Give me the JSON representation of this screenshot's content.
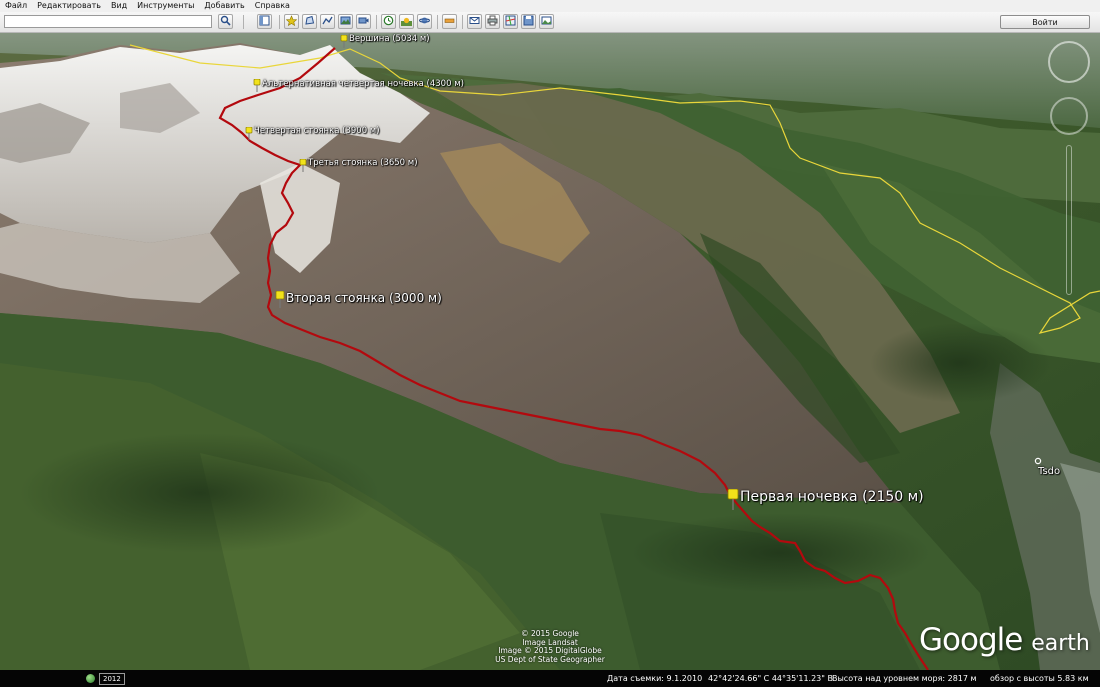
{
  "menu": [
    "Файл",
    "Редактировать",
    "Вид",
    "Инструменты",
    "Добавить",
    "Справка"
  ],
  "toolbar": {
    "search_value": "",
    "login_label": "Войти"
  },
  "map": {
    "summit_label": "Вершина (5034 м)",
    "alt_fourth_camp_label": "Альтернативная четвертая ночевка (4300 м)",
    "fourth_camp_label": "Четвертая стоянка (3900 м)",
    "third_camp_label": "Третья стоянка (3650 м)",
    "second_camp_label": "Вторая стоянка (3000 м)",
    "first_camp_label": "Первая ночевка (2150 м)",
    "village_label": "Tsdo",
    "route_color": "#b3090e",
    "border_color": "#e9d63a",
    "pin_color": "#f2e21a"
  },
  "copyright": [
    "© 2015 Google",
    "Image Landsat",
    "Image © 2015 DigitalGlobe",
    "US Dept of State Geographer"
  ],
  "logo": {
    "google": "Google",
    "earth": "earth"
  },
  "status": {
    "year": "2012",
    "imagery_date": "Дата съемки: 9.1.2010",
    "coords": "42°42'24.66\" С  44°35'11.23\" В",
    "elevation": "Высота над уровнем моря:  2817 м",
    "eye_alt": "обзор с высоты  5.83 км"
  }
}
